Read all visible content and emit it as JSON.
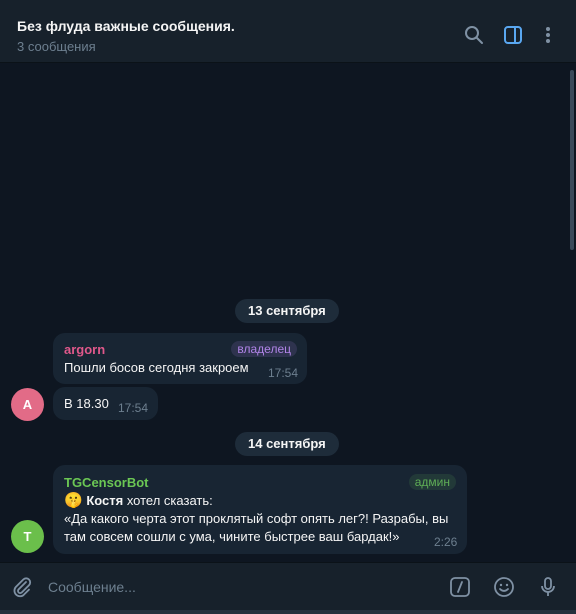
{
  "header": {
    "title": "Без флуда важные сообщения.",
    "subtitle": "3 сообщения",
    "icons": [
      "search-icon",
      "sidebar-toggle-icon",
      "more-vertical-icon"
    ]
  },
  "dates": [
    "13 сентября",
    "14 сентября"
  ],
  "messages": [
    {
      "sender": "argorn",
      "sender_color": "#e0588b",
      "badge": "владелец",
      "badge_color": "#b184e8",
      "text": "Пошли босов сегодня закроем",
      "time": "17:54"
    },
    {
      "text": "В 18.30",
      "time": "17:54",
      "avatar_letter": "A",
      "avatar_color": "#e26b87"
    },
    {
      "sender": "TGCensorBot",
      "sender_color": "#6bc754",
      "badge": "админ",
      "badge_color": "#5fae56",
      "emoji": "🤫",
      "bold_name": "Костя",
      "intro": "хотел сказать:",
      "line1": "«Да какого черта этот проклятый софт опять лег?! Разрабы, вы",
      "line2": "там совсем сошли с ума, чините быстрее ваш бардак!»",
      "time": "2:26",
      "avatar_letter": "T",
      "avatar_color": "#6bbf4b"
    }
  ],
  "composer": {
    "placeholder": "Сообщение...",
    "icons": [
      "attach-icon",
      "commands-icon",
      "emoji-icon",
      "microphone-icon"
    ]
  }
}
